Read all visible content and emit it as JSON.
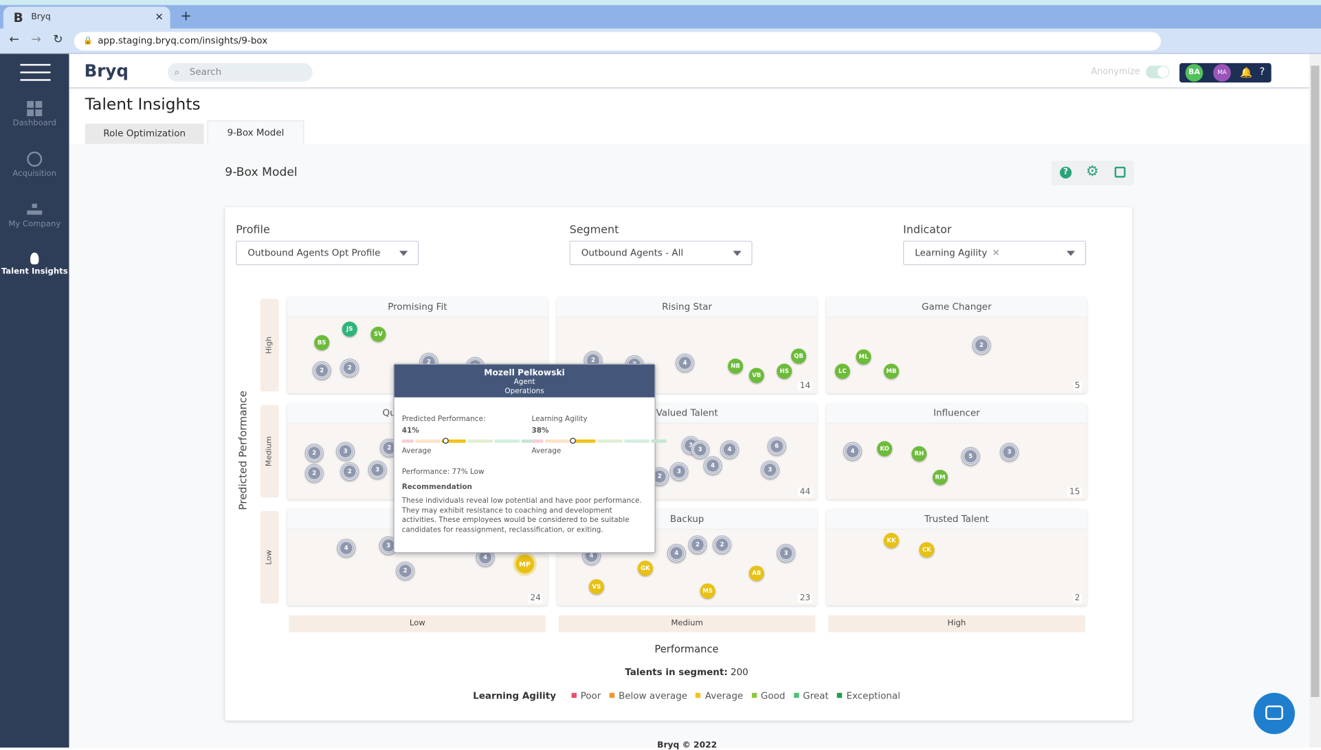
{
  "browser": {
    "tab_title": "Bryq",
    "url": "app.staging.bryq.com/insights/9-box"
  },
  "sidebar": {
    "items": [
      {
        "label": "Dashboard"
      },
      {
        "label": "Acquisition"
      },
      {
        "label": "My Company"
      },
      {
        "label": "Talent Insights"
      }
    ]
  },
  "topbar": {
    "logo": "Bryq",
    "search_placeholder": "Search",
    "anonymize": "Anonymize",
    "avatar1": "BA",
    "avatar2": "MA",
    "help": "?"
  },
  "page": {
    "title": "Talent Insights",
    "tabs": [
      {
        "label": "Role Optimization"
      },
      {
        "label": "9-Box Model",
        "active": true
      }
    ],
    "section_title": "9-Box Model"
  },
  "filters": {
    "profile_label": "Profile",
    "profile_value": "Outbound Agents Opt Profile",
    "segment_label": "Segment",
    "segment_value": "Outbound Agents - All",
    "indicator_label": "Indicator",
    "indicator_value": "Learning Agility"
  },
  "grid": {
    "y_axis_title": "Predicted Performance",
    "y_levels": [
      "High",
      "Medium",
      "Low"
    ],
    "x_axis_title": "Performance",
    "x_levels": [
      "Low",
      "Medium",
      "High"
    ],
    "cells": [
      {
        "title": "Promising Fit",
        "count": "",
        "bubbles": [
          [
            "BS",
            "g"
          ],
          [
            "JS",
            "t"
          ],
          [
            "SV",
            "g"
          ],
          [
            "2",
            "grp"
          ],
          [
            "2",
            "grp"
          ],
          [
            "2",
            "grp"
          ],
          [
            "2",
            "grp"
          ]
        ]
      },
      {
        "title": "Rising Star",
        "count": "14",
        "bubbles": [
          [
            "2",
            "grp"
          ],
          [
            "3",
            "grp"
          ],
          [
            "4",
            "grp"
          ],
          [
            "NB",
            "g"
          ],
          [
            "VB",
            "g"
          ],
          [
            "HS",
            "g"
          ],
          [
            "QB",
            "g"
          ]
        ]
      },
      {
        "title": "Game Changer",
        "count": "5",
        "bubbles": [
          [
            "2",
            "grp"
          ],
          [
            "ML",
            "g"
          ],
          [
            "LC",
            "g"
          ],
          [
            "MB",
            "g"
          ]
        ]
      },
      {
        "title": "Qu",
        "count": "",
        "bubbles": [
          [
            "2",
            "grp"
          ],
          [
            "3",
            "grp"
          ],
          [
            "2",
            "grp"
          ],
          [
            "2",
            "grp"
          ],
          [
            "3",
            "grp"
          ],
          [
            "2",
            "grp"
          ]
        ]
      },
      {
        "title": "Valued Talent",
        "count": "44",
        "bubbles": [
          [
            "3",
            "grp"
          ],
          [
            "3",
            "grp"
          ],
          [
            "4",
            "grp"
          ],
          [
            "6",
            "grp"
          ],
          [
            "4",
            "grp"
          ],
          [
            "3",
            "grp"
          ],
          [
            "3",
            "grp"
          ],
          [
            "2",
            "grp"
          ]
        ]
      },
      {
        "title": "Influencer",
        "count": "15",
        "bubbles": [
          [
            "4",
            "grp"
          ],
          [
            "KO",
            "g"
          ],
          [
            "RH",
            "g"
          ],
          [
            "5",
            "grp"
          ],
          [
            "3",
            "grp"
          ],
          [
            "RM",
            "g"
          ]
        ]
      },
      {
        "title": "",
        "count": "24",
        "bubbles": [
          [
            "4",
            "grp"
          ],
          [
            "3",
            "grp"
          ],
          [
            "4",
            "grp"
          ],
          [
            "2",
            "grp"
          ],
          [
            "MP",
            "y"
          ]
        ]
      },
      {
        "title": "Backup",
        "count": "23",
        "bubbles": [
          [
            "4",
            "grp"
          ],
          [
            "4",
            "grp"
          ],
          [
            "2",
            "grp"
          ],
          [
            "2",
            "grp"
          ],
          [
            "3",
            "grp"
          ],
          [
            "GK",
            "y"
          ],
          [
            "VS",
            "y"
          ],
          [
            "MS",
            "y"
          ],
          [
            "AB",
            "y"
          ]
        ]
      },
      {
        "title": "Trusted Talent",
        "count": "2",
        "bubbles": [
          [
            "KK",
            "y"
          ],
          [
            "CK",
            "y"
          ]
        ]
      }
    ]
  },
  "tooltip": {
    "name": "Mozell Pelkowski",
    "role": "Agent",
    "department": "Operations",
    "pp_label": "Predicted Performance:",
    "pp_value": "41%",
    "pp_level": "Average",
    "pp_fraction": 0.41,
    "la_label": "Learning Agility",
    "la_value": "38%",
    "la_level": "Average",
    "la_fraction": 0.38,
    "performance": "Performance: 77% Low",
    "rec_title": "Recommendation",
    "rec_text": "These individuals reveal low potential and have poor performance. They may exhibit resistance to coaching and development activities. These employees would be considered to be suitable candidates for reassignment, reclassification, or exiting."
  },
  "summary": {
    "label": "Talents in segment:",
    "value": "200"
  },
  "legend": {
    "title": "Learning Agility",
    "items": [
      {
        "label": "Poor",
        "color": "#e8506a"
      },
      {
        "label": "Below average",
        "color": "#f0962e"
      },
      {
        "label": "Average",
        "color": "#f2c318"
      },
      {
        "label": "Good",
        "color": "#8cc63f"
      },
      {
        "label": "Great",
        "color": "#4cc07a"
      },
      {
        "label": "Exceptional",
        "color": "#1e9e4c"
      }
    ]
  },
  "footer": {
    "text": "Bryq © 2022"
  }
}
